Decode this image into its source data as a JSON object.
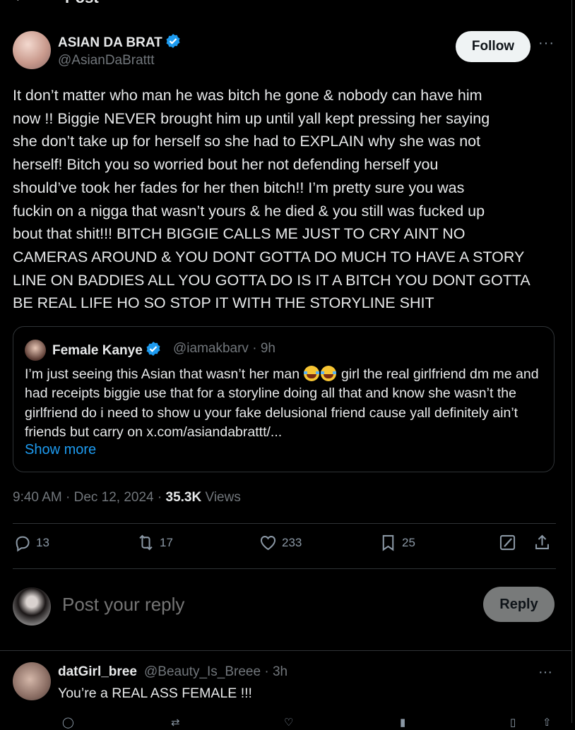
{
  "topbar": {
    "back_icon": "arrow-left-icon",
    "title": "Post"
  },
  "post": {
    "author_name": "ASIAN DA BRAT",
    "author_handle": "@AsianDaBrattt",
    "follow_label": "Follow",
    "more_icon": "···",
    "text": "It don’t matter who man he was bitch he gone & nobody can have him\nnow !! Biggie NEVER brought him up until yall kept pressing her saying\nshe don’t take up for herself so she had to EXPLAIN why she was not\nherself! Bitch you so worried bout her not defending herself you\nshould’ve took her fades for her then bitch!! I’m pretty sure you was\nfuckin on a nigga that wasn’t yours & he died & you still was fucked up\nbout that shit!!! BITCH BIGGIE CALLS ME JUST TO CRY AINT NO\nCAMERAS AROUND & YOU DONT GOTTA DO MUCH TO HAVE A STORY\nLINE ON BADDIES ALL YOU GOTTA DO IS IT A BITCH YOU DONT GOTTA\nBE REAL LIFE HO SO STOP IT WITH THE STORYLINE SHIT",
    "timestamp": "9:40 AM · Dec 12, 2024 · ",
    "views_count": "35.3K",
    "views_label": " Views"
  },
  "quote": {
    "name": "Female Kanye",
    "handle_time": "@iamakbarv · 9h",
    "text_before_emoji": "I’m just seeing this Asian that wasn’t her man ",
    "text_after_emoji": " girl the real girlfriend dm me and had receipts biggie use that for a storyline doing all that and know she wasn’t the girlfriend do i need to show u your fake delusional friend cause yall definitely ain’t friends but carry on x.com/asiandabrattt/...",
    "show_more": "Show more"
  },
  "actions": {
    "replies": "13",
    "reposts": "17",
    "likes": "233",
    "bookmarks": "25"
  },
  "reply_composer": {
    "placeholder": "Post your reply",
    "button_label": "Reply"
  },
  "reply": {
    "name": "datGirl_bree",
    "handle_time": "@Beauty_Is_Breee · 3h",
    "text": "You’re a REAL ASS FEMALE !!!",
    "more_icon": "···"
  },
  "colors": {
    "background": "#000000",
    "text": "#e7e9ea",
    "muted": "#71767b",
    "accent": "#1d9bf0",
    "border": "#2f3336"
  }
}
